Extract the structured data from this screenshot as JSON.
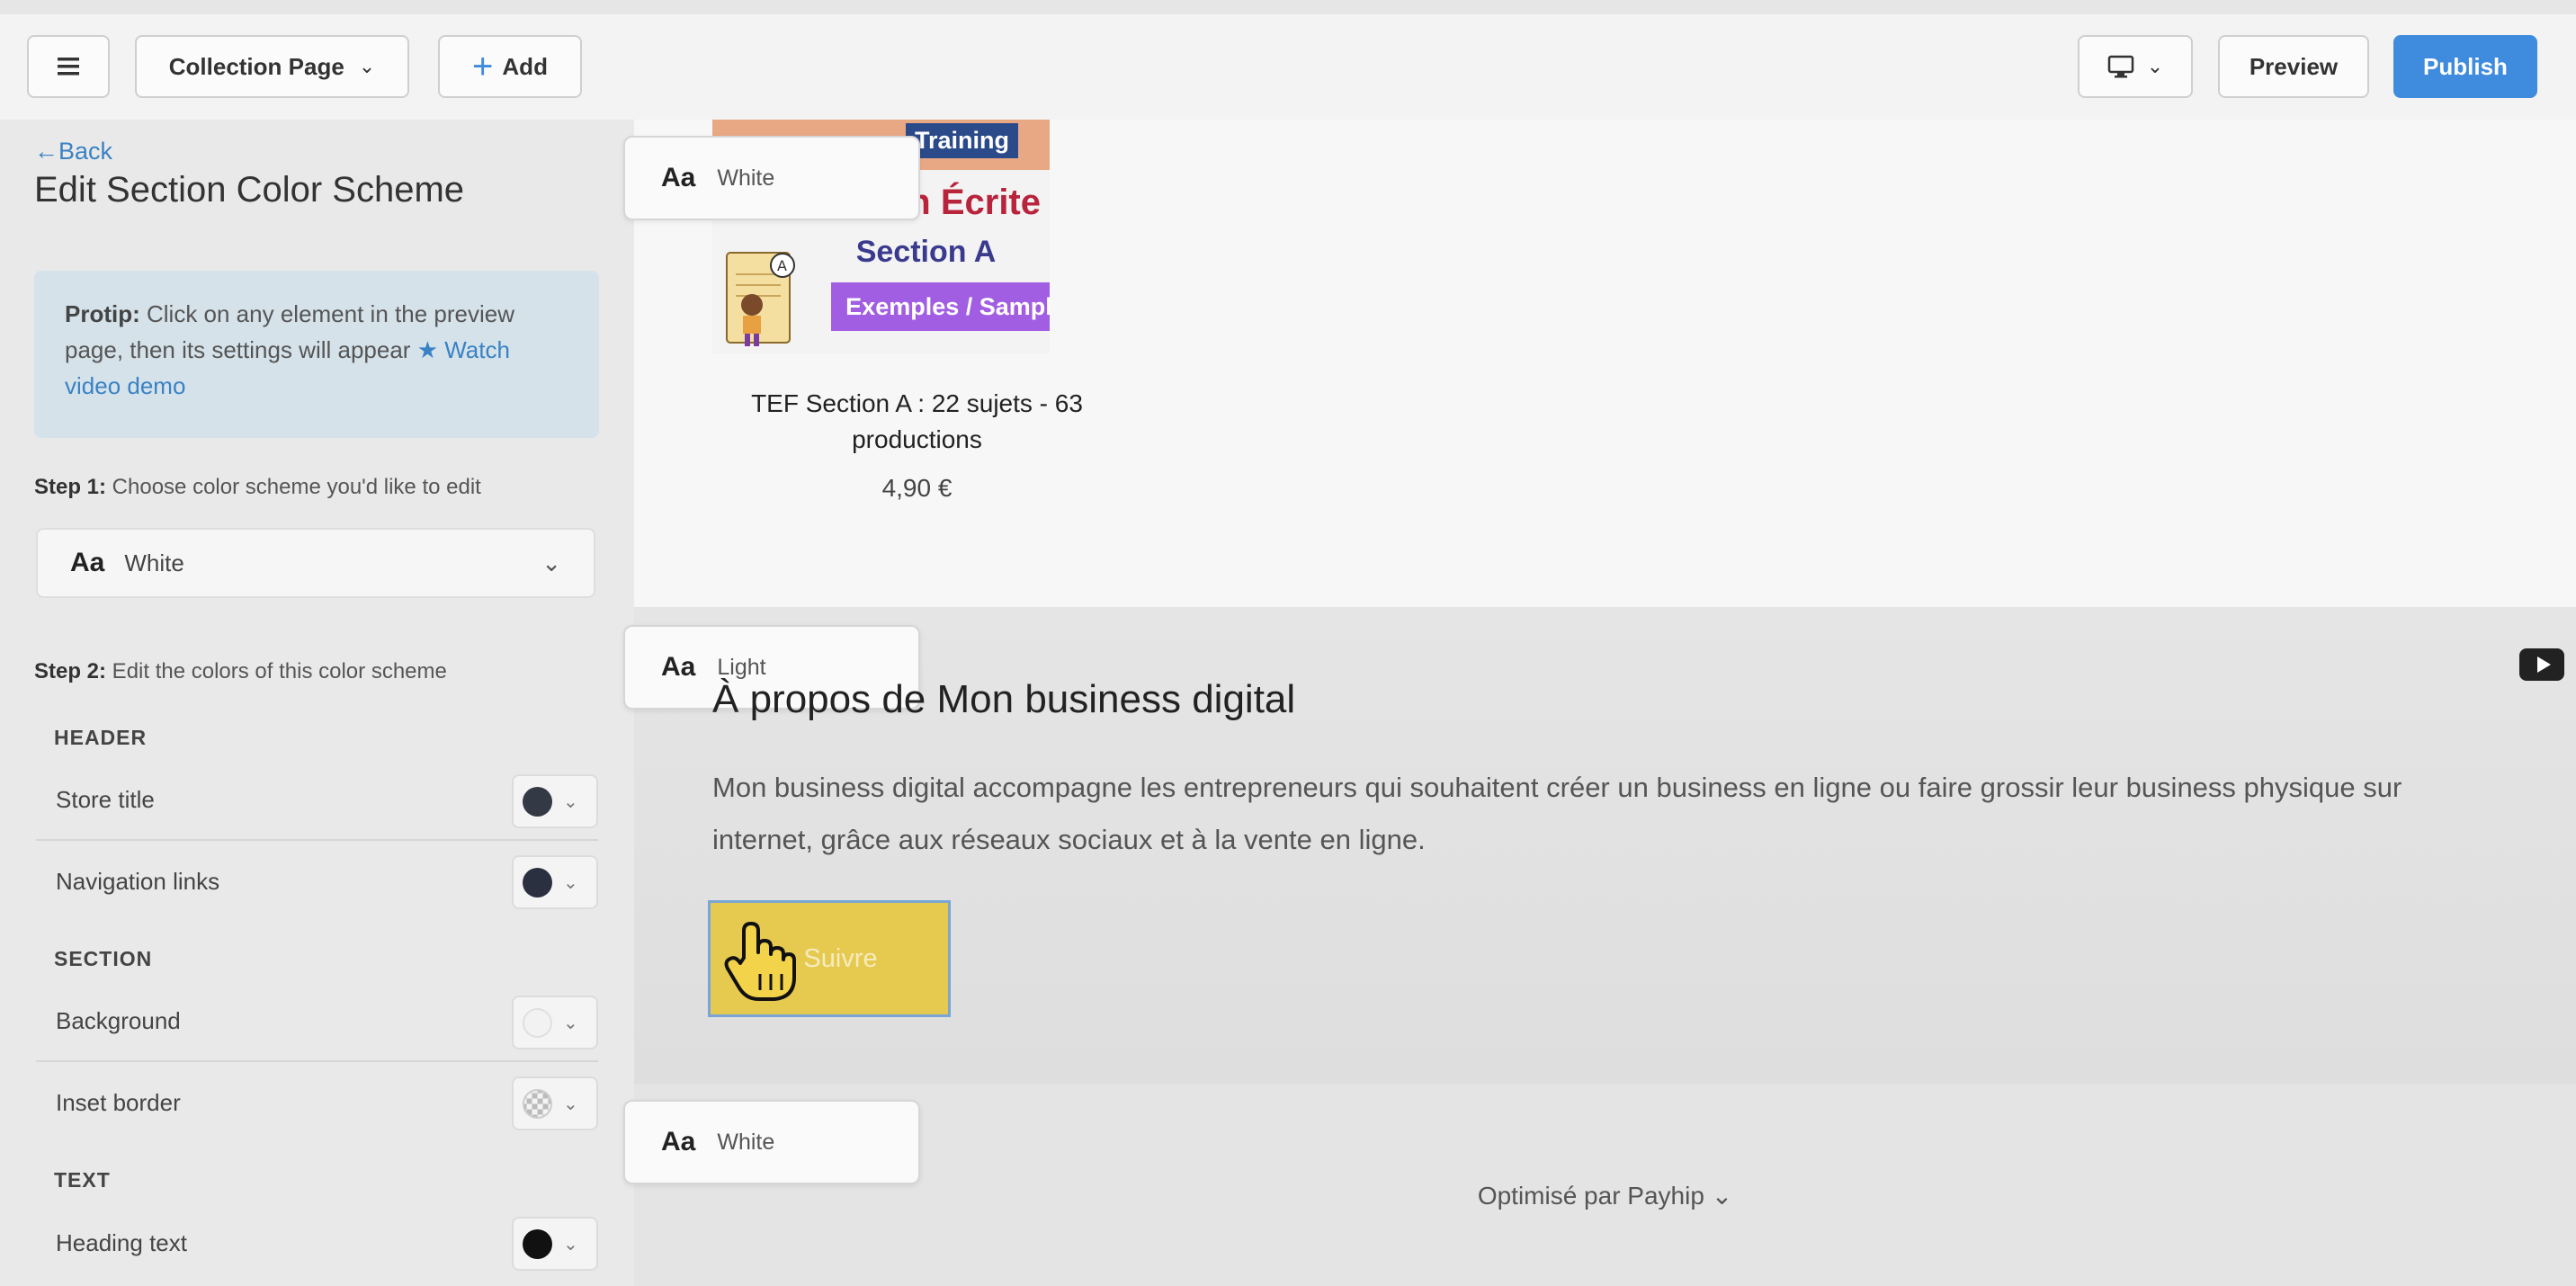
{
  "topbar": {
    "menu_icon": "hamburger-icon",
    "page_select": "Collection Page",
    "add_label": "Add",
    "device_icon": "desktop-icon",
    "preview_label": "Preview",
    "publish_label": "Publish",
    "publish_color": "#3f8bde"
  },
  "sidebar": {
    "back_label": "←Back",
    "title": "Edit Section Color Scheme",
    "protip": {
      "label": "Protip:",
      "text": " Click on any element in the preview page, then its settings will appear ",
      "link": "★ Watch video demo"
    },
    "step1": {
      "label": "Step 1:",
      "text": " Choose color scheme you'd like to edit"
    },
    "scheme_select": {
      "aa": "Aa",
      "value": "White"
    },
    "step2": {
      "label": "Step 2:",
      "text": " Edit the colors of this color scheme"
    },
    "groups": {
      "header": "HEADER",
      "section": "SECTION",
      "text": "TEXT"
    },
    "rows": {
      "store_title": {
        "label": "Store title",
        "color": "#333a45"
      },
      "navigation_links": {
        "label": "Navigation links",
        "color": "#2a3040"
      },
      "background": {
        "label": "Background",
        "color": "#f2f2f2"
      },
      "inset_border": {
        "label": "Inset border",
        "color": "transparent"
      },
      "heading_text": {
        "label": "Heading text",
        "color": "#111111"
      }
    }
  },
  "preview": {
    "chips": {
      "top": {
        "aa": "Aa",
        "label": "White"
      },
      "middle": {
        "aa": "Aa",
        "label": "Light"
      },
      "bottom": {
        "aa": "Aa",
        "label": "White"
      }
    },
    "product": {
      "img_training": "Training",
      "img_title": "n Écrite",
      "img_section": "Section A",
      "img_samples": "Exemples / Samples",
      "name": "TEF Section A : 22 sujets - 63 productions",
      "price": "4,90 €"
    },
    "about": {
      "title": "À propos de Mon business digital",
      "text": "Mon business digital accompagne les entrepreneurs qui souhaitent créer un business en ligne ou faire grossir leur business physique sur internet, grâce aux réseaux sociaux et à la vente en ligne.",
      "button": "+ Suivre",
      "button_color": "#e6c94f"
    },
    "footer": "Optimisé par Payhip ⌄"
  }
}
